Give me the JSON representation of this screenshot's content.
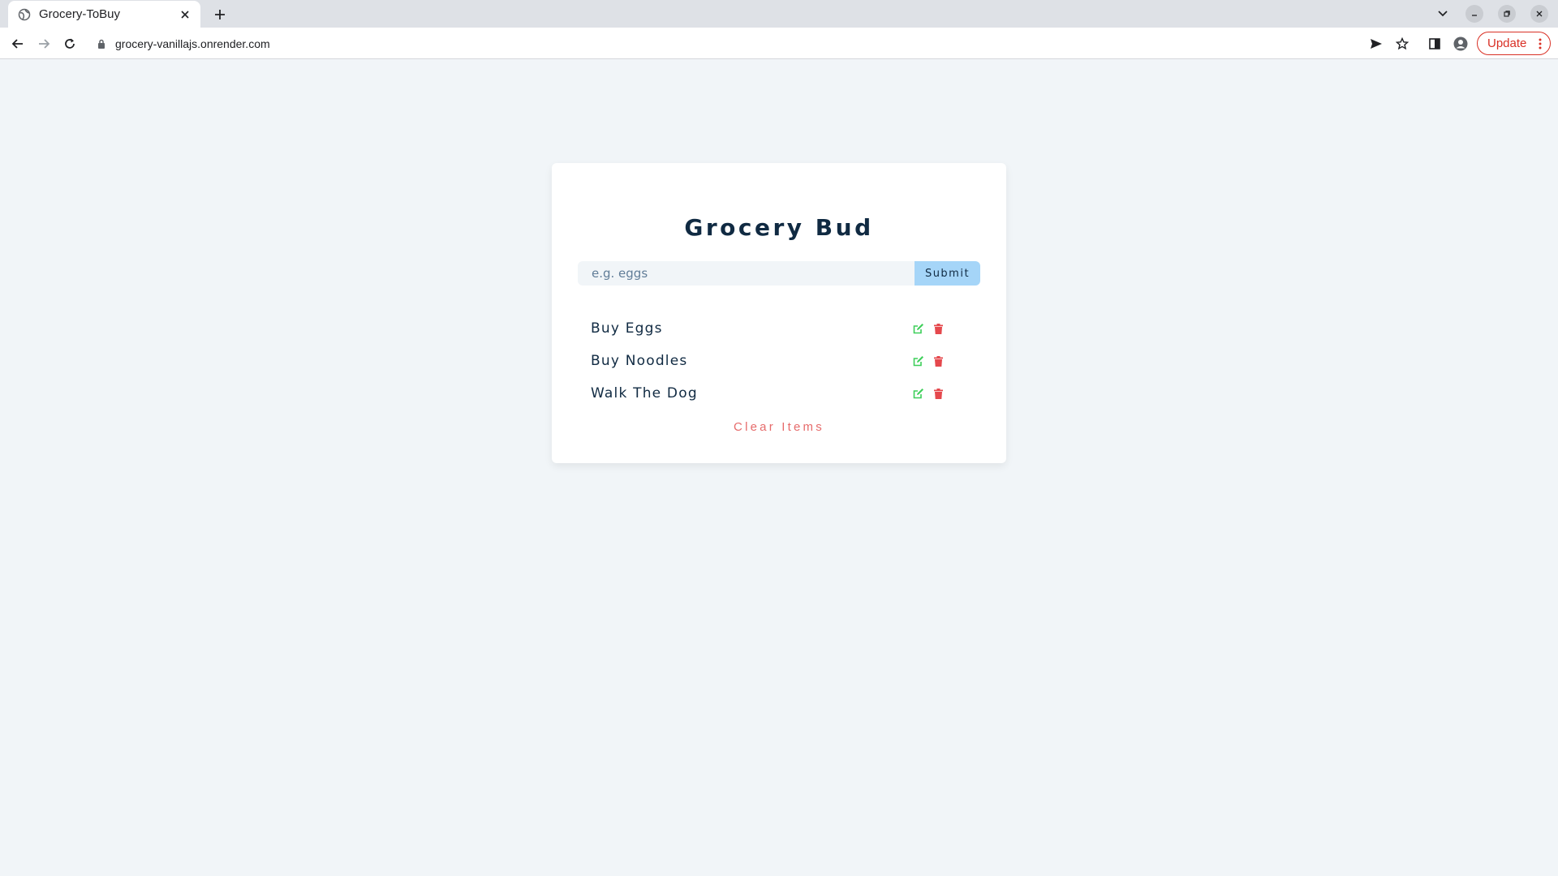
{
  "browser": {
    "tab_title": "Grocery-ToBuy",
    "url": "grocery-vanillajs.onrender.com",
    "update_label": "Update"
  },
  "app": {
    "title": "Grocery Bud",
    "input": {
      "placeholder": "e.g. eggs",
      "value": ""
    },
    "submit_label": "Submit",
    "items": [
      {
        "label": "Buy Eggs"
      },
      {
        "label": "Buy Noodles"
      },
      {
        "label": "Walk The Dog"
      }
    ],
    "clear_label": "Clear Items"
  },
  "colors": {
    "page_background": "#f1f5f8",
    "heading": "#102a42",
    "submit_background": "#a5d5f8",
    "edit_icon": "#3ecf5a",
    "delete_icon": "#e5484d",
    "clear_text": "#e66b6b",
    "update_accent": "#d93025"
  },
  "icons": {
    "tab": "globe-icon",
    "edit": "edit-icon",
    "delete": "trash-icon"
  }
}
